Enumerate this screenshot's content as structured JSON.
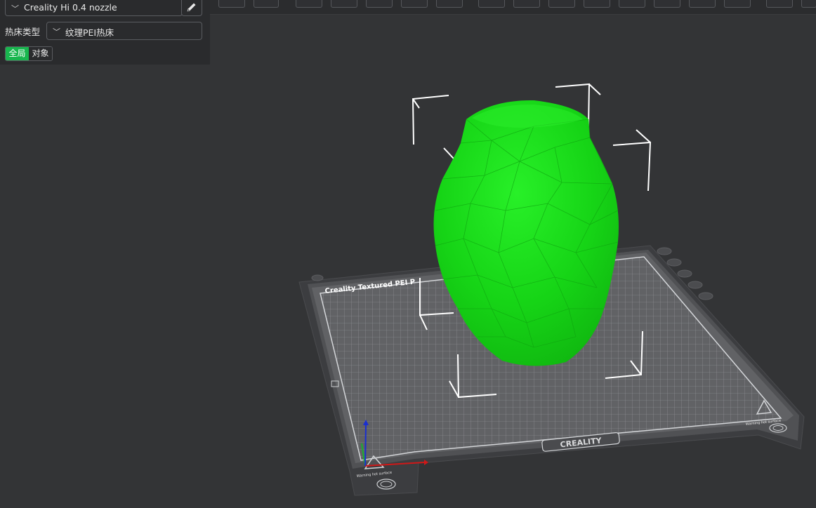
{
  "left_panel": {
    "nozzle": {
      "value": "Creality Hi 0.4 nozzle",
      "chevron_icon": "chevron-down-icon",
      "edit_icon": "pencil-icon"
    },
    "bed": {
      "label": "热床类型",
      "value": "纹理PEI热床",
      "chevron_icon": "chevron-down-icon"
    },
    "scope_tabs": [
      {
        "label": "全局",
        "active": true
      },
      {
        "label": "对象",
        "active": false
      }
    ],
    "accent_color": "#18b64e"
  },
  "viewport": {
    "model_color": "#1fdd1f",
    "plate_top_text": "Creality Textured PEI P",
    "plate_brand_text": "CREALITY",
    "plate_bottom_left_text": "Warning hot surface",
    "plate_bottom_right_text": "Warning hot surface",
    "axis_colors": {
      "x": "#d01818",
      "y": "#18b030",
      "z": "#1a2fd0"
    }
  }
}
